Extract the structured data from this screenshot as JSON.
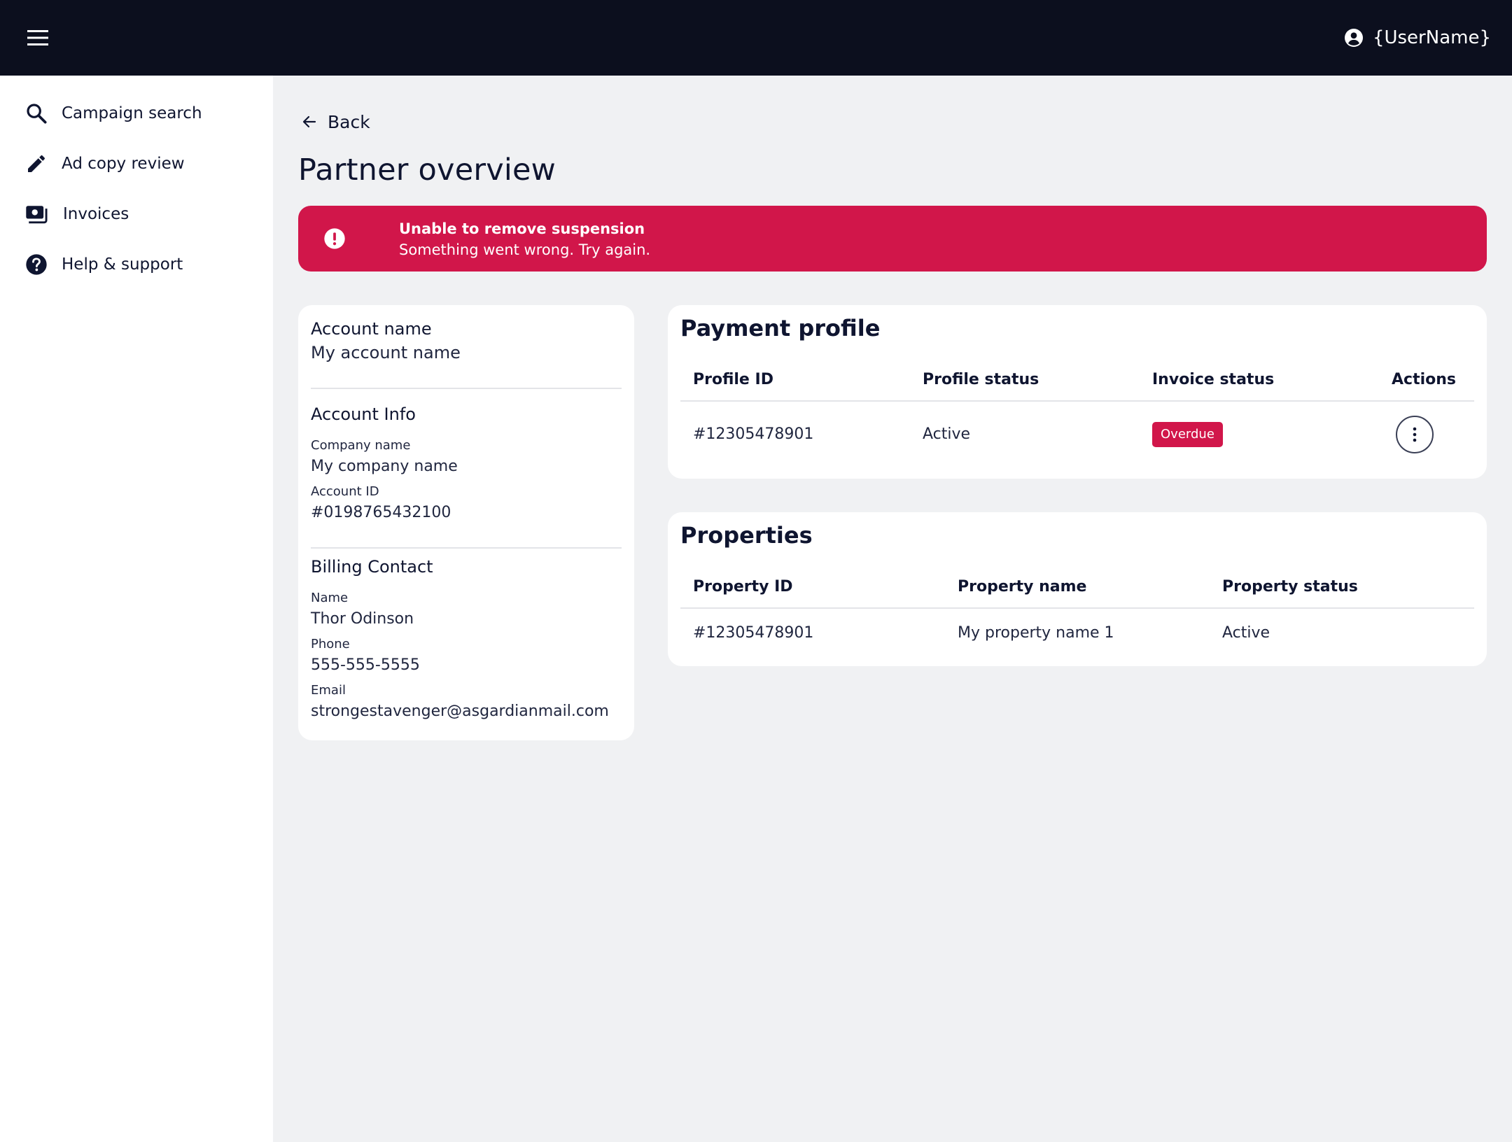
{
  "header": {
    "user_name": "{UserName}",
    "colors": {
      "bar": "#0c0f1e",
      "text": "#ffffff"
    }
  },
  "sidebar": {
    "items": [
      {
        "label": "Campaign search",
        "icon": "search-icon"
      },
      {
        "label": "Ad copy review",
        "icon": "pencil-icon"
      },
      {
        "label": "Invoices",
        "icon": "invoices-icon"
      },
      {
        "label": "Help & support",
        "icon": "help-icon"
      }
    ]
  },
  "main": {
    "back_label": "Back",
    "title": "Partner overview",
    "alert": {
      "title": "Unable to remove suspension",
      "message": "Something went wrong. Try again.",
      "icon": "error-icon",
      "color": "#d1164a"
    },
    "account": {
      "name_label": "Account name",
      "name_value": "My account name",
      "info_title": "Account Info",
      "company_label": "Company name",
      "company_value": "My company name",
      "id_label": "Account ID",
      "id_value": "#0198765432100",
      "billing_title": "Billing Contact",
      "contact_name_label": "Name",
      "contact_name_value": "Thor Odinson",
      "phone_label": "Phone",
      "phone_value": "555-555-5555",
      "email_label": "Email",
      "email_value": "strongestavenger@asgardianmail.com"
    },
    "payment_profile": {
      "title": "Payment profile",
      "columns": [
        "Profile ID",
        "Profile status",
        "Invoice status",
        "Actions"
      ],
      "rows": [
        {
          "profile_id": "#12305478901",
          "profile_status": "Active",
          "invoice_status": "Overdue",
          "actions_icon": "more-vertical-icon"
        }
      ]
    },
    "properties": {
      "title": "Properties",
      "columns": [
        "Property ID",
        "Property name",
        "Property status"
      ],
      "rows": [
        {
          "property_id": "#12305478901",
          "property_name": "My property name 1",
          "property_status": "Active"
        }
      ]
    }
  }
}
